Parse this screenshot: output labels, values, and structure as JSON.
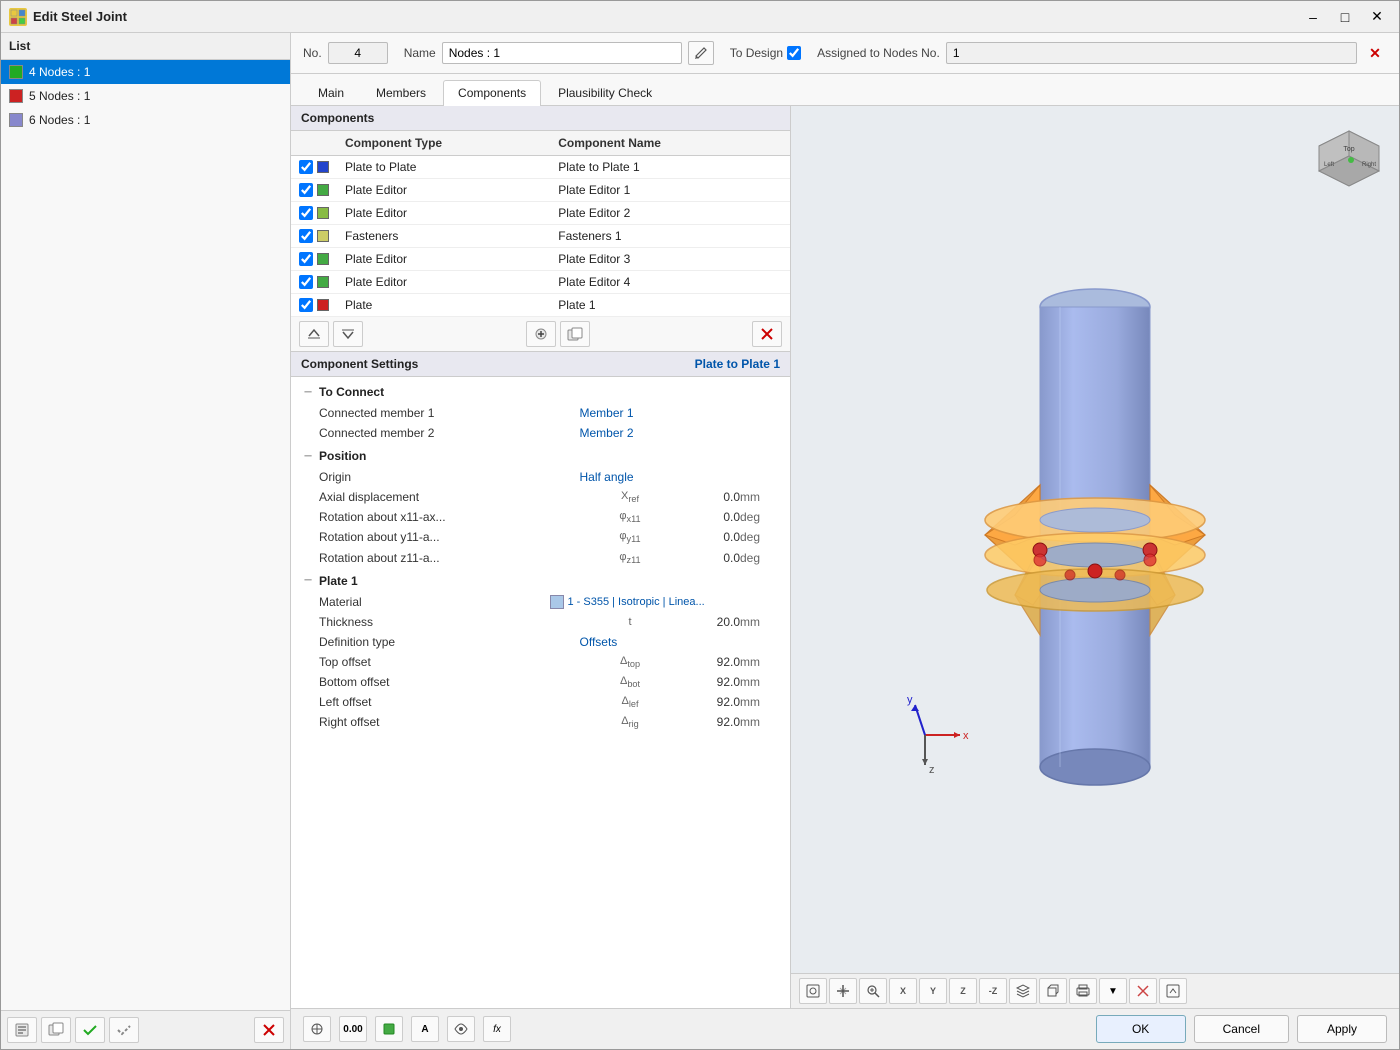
{
  "titleBar": {
    "title": "Edit Steel Joint",
    "iconText": "SJ"
  },
  "header": {
    "noLabel": "No.",
    "noValue": "4",
    "nameLabel": "Name",
    "nameValue": "Nodes : 1",
    "toDesignLabel": "To Design",
    "assignedLabel": "Assigned to Nodes No.",
    "assignedValue": "1"
  },
  "tabs": {
    "items": [
      {
        "label": "Main",
        "active": false
      },
      {
        "label": "Members",
        "active": false
      },
      {
        "label": "Components",
        "active": true
      },
      {
        "label": "Plausibility Check",
        "active": false
      }
    ]
  },
  "list": {
    "header": "List",
    "items": [
      {
        "id": 1,
        "label": "4 Nodes : 1",
        "color": "#22aa22",
        "selected": true
      },
      {
        "id": 2,
        "label": "5 Nodes : 1",
        "color": "#cc2222",
        "selected": false
      },
      {
        "id": 3,
        "label": "6 Nodes : 1",
        "color": "#8888cc",
        "selected": false
      }
    ]
  },
  "components": {
    "sectionHeader": "Components",
    "tableHeaders": [
      "Component Type",
      "Component Name"
    ],
    "rows": [
      {
        "checked": true,
        "color": "#2244cc",
        "type": "Plate to Plate",
        "name": "Plate to Plate 1"
      },
      {
        "checked": true,
        "color": "#44aa44",
        "type": "Plate Editor",
        "name": "Plate Editor 1"
      },
      {
        "checked": true,
        "color": "#88bb44",
        "type": "Plate Editor",
        "name": "Plate Editor 2"
      },
      {
        "checked": true,
        "color": "#cccc66",
        "type": "Fasteners",
        "name": "Fasteners 1"
      },
      {
        "checked": true,
        "color": "#44aa44",
        "type": "Plate Editor",
        "name": "Plate Editor 3"
      },
      {
        "checked": true,
        "color": "#44aa44",
        "type": "Plate Editor",
        "name": "Plate Editor 4"
      },
      {
        "checked": true,
        "color": "#cc2222",
        "type": "Plate",
        "name": "Plate 1"
      }
    ]
  },
  "componentSettings": {
    "title": "Component Settings",
    "activeName": "Plate to Plate 1",
    "sections": [
      {
        "id": "toConnect",
        "label": "To Connect",
        "collapsed": false,
        "rows": [
          {
            "label": "Connected member 1",
            "symbol": "",
            "value": "Member 1",
            "unit": "",
            "isText": true
          },
          {
            "label": "Connected member 2",
            "symbol": "",
            "value": "Member 2",
            "unit": "",
            "isText": true
          }
        ]
      },
      {
        "id": "position",
        "label": "Position",
        "collapsed": false,
        "rows": [
          {
            "label": "Origin",
            "symbol": "",
            "value": "Half angle",
            "unit": "",
            "isText": true
          },
          {
            "label": "Axial displacement",
            "symbol": "Xref",
            "value": "0.0",
            "unit": "mm",
            "isText": false
          },
          {
            "label": "Rotation about x11-ax...",
            "symbol": "φx11",
            "value": "0.0",
            "unit": "deg",
            "isText": false
          },
          {
            "label": "Rotation about y11-a...",
            "symbol": "φy11",
            "value": "0.0",
            "unit": "deg",
            "isText": false
          },
          {
            "label": "Rotation about z11-a...",
            "symbol": "φz11",
            "value": "0.0",
            "unit": "deg",
            "isText": false
          }
        ]
      },
      {
        "id": "plate1",
        "label": "Plate 1",
        "collapsed": false,
        "rows": [
          {
            "label": "Material",
            "symbol": "",
            "value": "1 - S355 | Isotropic | Linea...",
            "unit": "",
            "isText": true,
            "hasSwatch": true
          },
          {
            "label": "Thickness",
            "symbol": "t",
            "value": "20.0",
            "unit": "mm",
            "isText": false
          },
          {
            "label": "Definition type",
            "symbol": "",
            "value": "Offsets",
            "unit": "",
            "isText": true
          },
          {
            "label": "Top offset",
            "symbol": "Δtop",
            "value": "92.0",
            "unit": "mm",
            "isText": false
          },
          {
            "label": "Bottom offset",
            "symbol": "Δbot",
            "value": "92.0",
            "unit": "mm",
            "isText": false
          },
          {
            "label": "Left offset",
            "symbol": "Δlef",
            "value": "92.0",
            "unit": "mm",
            "isText": false
          },
          {
            "label": "Right offset",
            "symbol": "Δrig",
            "value": "92.0",
            "unit": "mm",
            "isText": false
          }
        ]
      }
    ]
  },
  "bottomBar": {
    "icons": [
      "grid",
      "value",
      "green-sq",
      "text",
      "eye",
      "fx"
    ]
  },
  "buttons": {
    "ok": "OK",
    "cancel": "Cancel",
    "apply": "Apply"
  },
  "colors": {
    "accent": "#0078d7",
    "listSelected": "#0078d7",
    "componentBg": "#e8ecf0"
  }
}
